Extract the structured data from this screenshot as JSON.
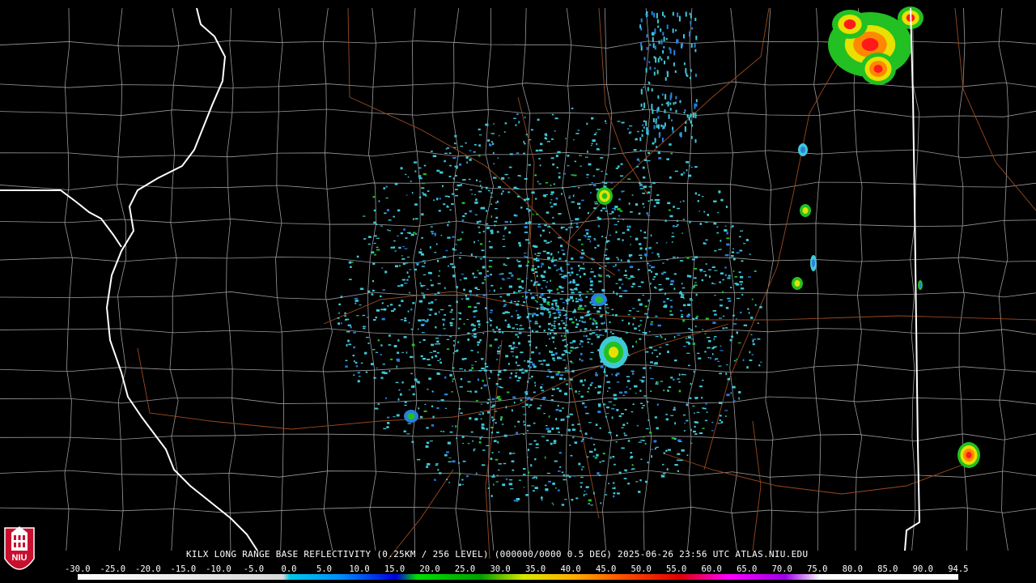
{
  "product": {
    "caption": "KILX LONG RANGE BASE REFLECTIVITY (0.25KM / 256 LEVEL) (000000/0000 0.5 DEG) 2025-06-26 23:56 UTC  ATLAS.NIU.EDU"
  },
  "logo": {
    "text": "NIU"
  },
  "colorscale": {
    "labels": [
      "-30.0",
      "-25.0",
      "-20.0",
      "-15.0",
      "-10.0",
      "-5.0",
      "0.0",
      "5.0",
      "10.0",
      "15.0",
      "20.0",
      "25.0",
      "30.0",
      "35.0",
      "40.0",
      "45.0",
      "50.0",
      "55.0",
      "60.0",
      "65.0",
      "70.0",
      "75.0",
      "80.0",
      "85.0",
      "90.0",
      "94.5"
    ],
    "stops": [
      {
        "value": -30,
        "color": "#ffffff"
      },
      {
        "value": -1,
        "color": "#d8d8d8"
      },
      {
        "value": 0,
        "color": "#00c8e8"
      },
      {
        "value": 7,
        "color": "#0090ff"
      },
      {
        "value": 15,
        "color": "#0000e0"
      },
      {
        "value": 18,
        "color": "#00e000"
      },
      {
        "value": 27,
        "color": "#00a000"
      },
      {
        "value": 33,
        "color": "#d8e800"
      },
      {
        "value": 40,
        "color": "#ffb000"
      },
      {
        "value": 47,
        "color": "#ff5000"
      },
      {
        "value": 55,
        "color": "#e00000"
      },
      {
        "value": 62,
        "color": "#ff00ff"
      },
      {
        "value": 70,
        "color": "#a000e8"
      },
      {
        "value": 75,
        "color": "#ffffff"
      },
      {
        "value": 94.5,
        "color": "#ffffff"
      }
    ]
  },
  "radar": {
    "site": "KILX",
    "echo_colors": {
      "light": "#3fc9d8",
      "mid": "#2a7fe0",
      "green": "#22c022",
      "yellow": "#e8e000",
      "orange": "#ff8800",
      "red": "#ff1a1a"
    }
  },
  "map_colors": {
    "background": "#000000",
    "county_lines": "#9a9a9a",
    "state_lines": "#ffffff",
    "roads": "#9a4a1e"
  }
}
